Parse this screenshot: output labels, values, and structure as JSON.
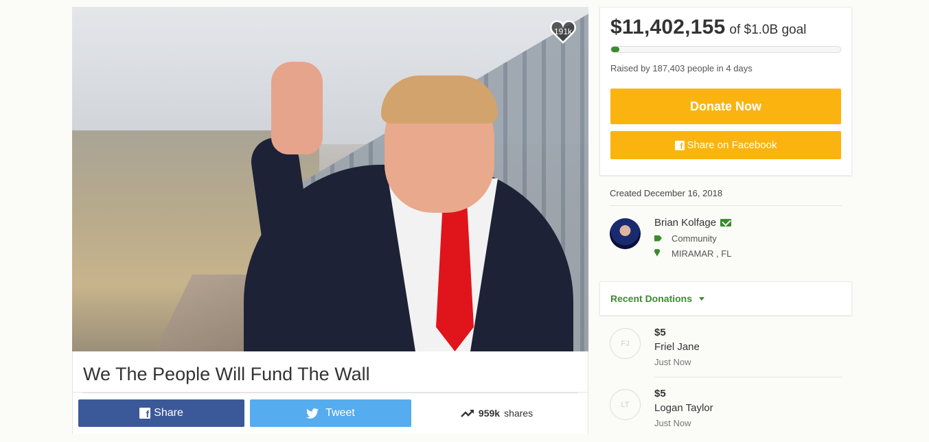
{
  "campaign": {
    "title": "We The People Will Fund The Wall",
    "hearts": "191k"
  },
  "share_bar": {
    "facebook_label": "Share",
    "tweet_label": "Tweet",
    "shares_count": "959k",
    "shares_label": "shares"
  },
  "funding": {
    "amount": "$11,402,155",
    "goal_text": "of $1.0B goal",
    "progress_percent": 1.14,
    "raised_by": "Raised by 187,403 people in 4 days",
    "donate_label": "Donate Now",
    "share_facebook_label": "Share on Facebook"
  },
  "meta": {
    "created": "Created December 16, 2018",
    "organizer_name": "Brian Kolfage",
    "category": "Community",
    "location": "MIRAMAR , FL"
  },
  "recent": {
    "header": "Recent Donations",
    "donations": [
      {
        "initials": "FJ",
        "amount": "$5",
        "name": "Friel Jane",
        "time": "Just Now"
      },
      {
        "initials": "LT",
        "amount": "$5",
        "name": "Logan Taylor",
        "time": "Just Now"
      }
    ]
  },
  "colors": {
    "brand_green": "#3c8a2e",
    "donate_yellow": "#fbb40f",
    "facebook_blue": "#3b5998",
    "twitter_blue": "#55acee"
  }
}
